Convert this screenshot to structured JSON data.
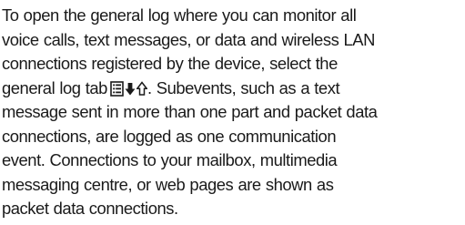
{
  "paragraph": {
    "lines": [
      "To open the general log where you can monitor all",
      "voice calls, text messages, or data and wireless LAN",
      "connections registered by the device, select the",
      "general log tab",
      ". Subevents, such as a text",
      "message sent in more than one part and packet data",
      "connections, are logged as one communication",
      "event. Connections to your mailbox, multimedia",
      "messaging centre, or web pages are shown as",
      "packet data connections."
    ],
    "icons": [
      "general-log-list-icon",
      "down-arrow-icon",
      "up-arrow-icon"
    ]
  }
}
